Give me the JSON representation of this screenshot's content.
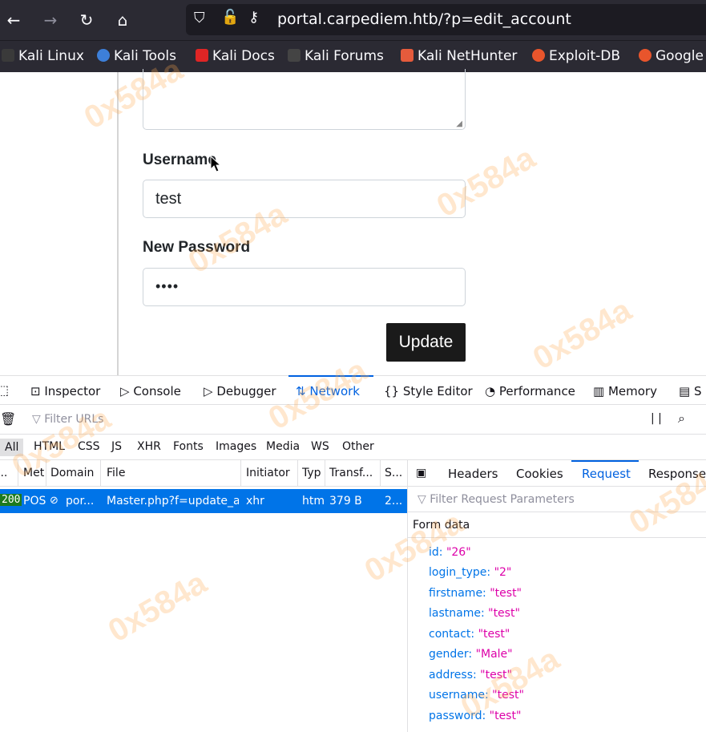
{
  "browser": {
    "url": "portal.carpediem.htb/?p=edit_account",
    "bookmarks": [
      "Kali Linux",
      "Kali Tools",
      "Kali Docs",
      "Kali Forums",
      "Kali NetHunter",
      "Exploit-DB",
      "Google"
    ]
  },
  "form": {
    "username_label": "Username",
    "username_value": "test",
    "password_label": "New Password",
    "password_value": "••••",
    "update_label": "Update"
  },
  "devtools": {
    "tabs": [
      "Inspector",
      "Console",
      "Debugger",
      "Network",
      "Style Editor",
      "Performance",
      "Memory",
      "S"
    ],
    "filter_placeholder": "Filter URLs",
    "pause_label": "| |",
    "types": [
      "All",
      "HTML",
      "CSS",
      "JS",
      "XHR",
      "Fonts",
      "Images",
      "Media",
      "WS",
      "Other"
    ],
    "columns": [
      "...",
      "Met",
      "Domain",
      "File",
      "Initiator",
      "Typ",
      "Transf...",
      "S..."
    ],
    "request": {
      "status": "200",
      "method": "POS",
      "domain": "por...",
      "file": "Master.php?f=update_acco",
      "initiator": "xhr",
      "type": "html",
      "transferred": "379 B",
      "size": "2..."
    },
    "side_tabs": [
      "Headers",
      "Cookies",
      "Request",
      "Response"
    ],
    "side_filter": "Filter Request Parameters",
    "form_data_heading": "Form data",
    "params": [
      {
        "key": "id:",
        "value": "\"26\""
      },
      {
        "key": "login_type:",
        "value": "\"2\""
      },
      {
        "key": "firstname:",
        "value": "\"test\""
      },
      {
        "key": "lastname:",
        "value": "\"test\""
      },
      {
        "key": "contact:",
        "value": "\"test\""
      },
      {
        "key": "gender:",
        "value": "\"Male\""
      },
      {
        "key": "address:",
        "value": "\"test\""
      },
      {
        "key": "username:",
        "value": "\"test\""
      },
      {
        "key": "password:",
        "value": "\"test\""
      }
    ]
  },
  "watermark": "0x584a",
  "colors": {
    "accent": "#0061e0",
    "selected_row": "#0074e8",
    "param_key": "#0074e8",
    "param_value": "#dd00a9"
  }
}
